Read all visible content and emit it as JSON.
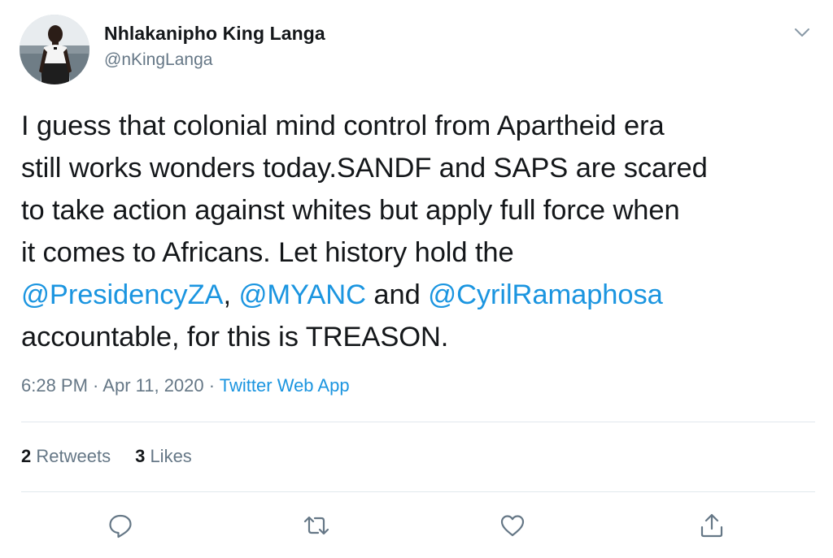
{
  "author": {
    "name": "Nhlakanipho King Langa",
    "handle": "@nKingLanga",
    "avatar_icon": "profile-photo"
  },
  "tweet": {
    "lines": [
      [
        {
          "text": "I guess that colonial mind control from Apartheid era",
          "mention": false
        }
      ],
      [
        {
          "text": "still works wonders today.SANDF and SAPS are scared",
          "mention": false
        }
      ],
      [
        {
          "text": "to take action against whites but apply full force when",
          "mention": false
        }
      ],
      [
        {
          "text": "it comes to Africans. Let history hold the",
          "mention": false
        }
      ],
      [
        {
          "text": "@PresidencyZA",
          "mention": true
        },
        {
          "text": ", ",
          "mention": false
        },
        {
          "text": "@MYANC",
          "mention": true
        },
        {
          "text": " and ",
          "mention": false
        },
        {
          "text": "@CyrilRamaphosa",
          "mention": true
        }
      ],
      [
        {
          "text": "accountable, for this is TREASON.",
          "mention": false
        }
      ]
    ]
  },
  "meta": {
    "time": "6:28 PM",
    "separator": " · ",
    "date": "Apr 11, 2020",
    "source": "Twitter Web App"
  },
  "stats": {
    "retweets_count": "2",
    "retweets_label": " Retweets",
    "likes_count": "3",
    "likes_label": " Likes"
  },
  "actions": [
    "reply-icon",
    "retweet-icon",
    "like-icon",
    "share-icon"
  ],
  "colors": {
    "link": "#1b95e0",
    "secondary_text": "#657786",
    "primary_text": "#14171a",
    "divider": "#e1e8ed"
  }
}
